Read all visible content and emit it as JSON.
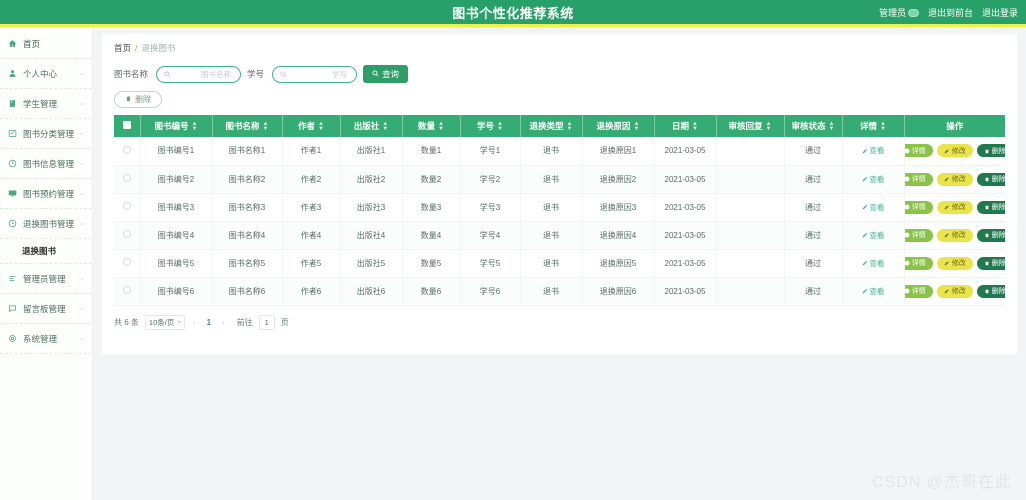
{
  "header": {
    "title": "图书个性化推荐系统",
    "user": "管理员",
    "exit_front": "退出到前台",
    "logout": "退出登录"
  },
  "sidebar": {
    "items": [
      {
        "label": "首页",
        "icon": "home-icon",
        "arrow": ""
      },
      {
        "label": "个人中心",
        "icon": "user-icon",
        "arrow": "⌄"
      },
      {
        "label": "学生管理",
        "icon": "book-icon",
        "arrow": "⌄"
      },
      {
        "label": "图书分类管理",
        "icon": "grid-icon",
        "arrow": "⌄"
      },
      {
        "label": "图书信息管理",
        "icon": "clock-icon",
        "arrow": "⌄"
      },
      {
        "label": "图书预约管理",
        "icon": "monitor-icon",
        "arrow": "⌄"
      },
      {
        "label": "退换图书管理",
        "icon": "refresh-icon",
        "arrow": "⌄"
      }
    ],
    "submenu": {
      "label": "退换图书"
    },
    "items_after": [
      {
        "label": "管理员管理",
        "icon": "list-icon",
        "arrow": "⌄"
      },
      {
        "label": "留言板管理",
        "icon": "message-icon",
        "arrow": "⌄"
      },
      {
        "label": "系统管理",
        "icon": "settings-icon",
        "arrow": "⌄"
      }
    ]
  },
  "breadcrumb": {
    "home": "首页",
    "sep": "/",
    "current": "退换图书"
  },
  "search": {
    "book_label": "图书名称",
    "book_placeholder": "图书名称",
    "book_value": "",
    "sid_label": "学号",
    "sid_placeholder": "学号",
    "sid_value": "",
    "query_button": "查询"
  },
  "toolbar": {
    "delete_label": "删除"
  },
  "table": {
    "columns": [
      {
        "label": "图书编号",
        "sortable": true
      },
      {
        "label": "图书名称",
        "sortable": true
      },
      {
        "label": "作者",
        "sortable": true
      },
      {
        "label": "出版社",
        "sortable": true
      },
      {
        "label": "数量",
        "sortable": true
      },
      {
        "label": "学号",
        "sortable": true
      },
      {
        "label": "退换类型",
        "sortable": true
      },
      {
        "label": "退换原因",
        "sortable": true
      },
      {
        "label": "日期",
        "sortable": true
      },
      {
        "label": "审核回复",
        "sortable": true
      },
      {
        "label": "审核状态",
        "sortable": true
      },
      {
        "label": "详情",
        "sortable": true
      },
      {
        "label": "操作",
        "sortable": false
      }
    ],
    "rows": [
      {
        "book_id": "图书编号1",
        "book_name": "图书名称1",
        "author": "作者1",
        "publisher": "出版社1",
        "qty": "数量1",
        "student_id": "学号1",
        "type": "退书",
        "reason": "退换原因1",
        "date": "2021-03-05",
        "reply": "",
        "status": "通过",
        "detail": "查看"
      },
      {
        "book_id": "图书编号2",
        "book_name": "图书名称2",
        "author": "作者2",
        "publisher": "出版社2",
        "qty": "数量2",
        "student_id": "学号2",
        "type": "退书",
        "reason": "退换原因2",
        "date": "2021-03-05",
        "reply": "",
        "status": "通过",
        "detail": "查看"
      },
      {
        "book_id": "图书编号3",
        "book_name": "图书名称3",
        "author": "作者3",
        "publisher": "出版社3",
        "qty": "数量3",
        "student_id": "学号3",
        "type": "退书",
        "reason": "退换原因3",
        "date": "2021-03-05",
        "reply": "",
        "status": "通过",
        "detail": "查看"
      },
      {
        "book_id": "图书编号4",
        "book_name": "图书名称4",
        "author": "作者4",
        "publisher": "出版社4",
        "qty": "数量4",
        "student_id": "学号4",
        "type": "退书",
        "reason": "退换原因4",
        "date": "2021-03-05",
        "reply": "",
        "status": "通过",
        "detail": "查看"
      },
      {
        "book_id": "图书编号5",
        "book_name": "图书名称5",
        "author": "作者5",
        "publisher": "出版社5",
        "qty": "数量5",
        "student_id": "学号5",
        "type": "退书",
        "reason": "退换原因5",
        "date": "2021-03-05",
        "reply": "",
        "status": "通过",
        "detail": "查看"
      },
      {
        "book_id": "图书编号6",
        "book_name": "图书名称6",
        "author": "作者6",
        "publisher": "出版社6",
        "qty": "数量6",
        "student_id": "学号6",
        "type": "退书",
        "reason": "退换原因6",
        "date": "2021-03-05",
        "reply": "",
        "status": "通过",
        "detail": "查看"
      }
    ],
    "row_actions": {
      "detail": "详情",
      "edit": "修改",
      "delete": "删除"
    }
  },
  "pagination": {
    "total": "共 6 条",
    "page_size": "10条/页",
    "prev": "‹",
    "current_page": "1",
    "next": "›",
    "jump_label": "前往",
    "jump_value": "1",
    "jump_suffix": "页"
  },
  "watermark": "CSDN @杰哥在此",
  "colors": {
    "brand_green": "#28a06a",
    "accent_yellow": "#e8f44b",
    "table_header": "#35ac74",
    "detail_btn": "#8bc34a",
    "edit_btn": "#e9e44b",
    "delete_btn": "#1f7a4d"
  }
}
